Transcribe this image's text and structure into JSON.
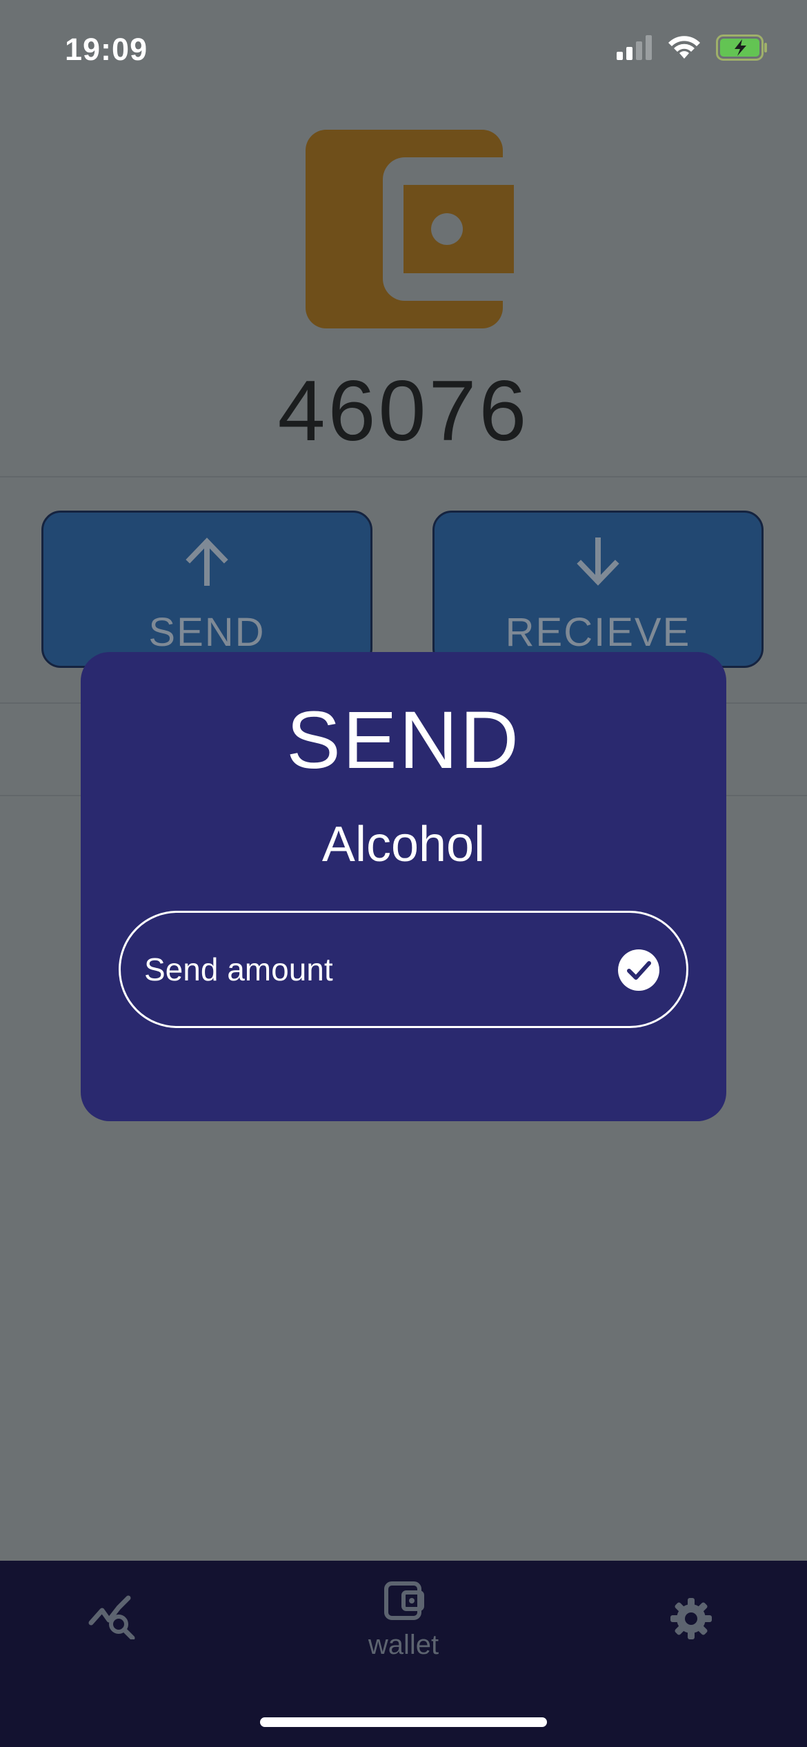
{
  "status_bar": {
    "time": "19:09",
    "icons": [
      "cellular-signal-icon",
      "wifi-icon",
      "battery-charging-icon"
    ]
  },
  "wallet": {
    "icon": "wallet-icon",
    "balance": "46076"
  },
  "actions": {
    "send_label": "SEND",
    "send_icon": "arrow-up-icon",
    "receive_label": "RECIEVE",
    "receive_icon": "arrow-down-icon"
  },
  "modal": {
    "title": "SEND",
    "subtitle": "Alcohol",
    "amount_placeholder": "Send amount",
    "confirm_icon": "check-circle-icon"
  },
  "bottom_nav": {
    "items": [
      {
        "icon": "chart-search-icon",
        "label": ""
      },
      {
        "icon": "wallet-icon",
        "label": "wallet"
      },
      {
        "icon": "gear-icon",
        "label": ""
      }
    ]
  },
  "colors": {
    "background": "#6c7173",
    "wallet_icon": "#6f4f1a",
    "action_button": "#224872",
    "modal": "#2a296f",
    "bottom_nav": "#131230"
  }
}
